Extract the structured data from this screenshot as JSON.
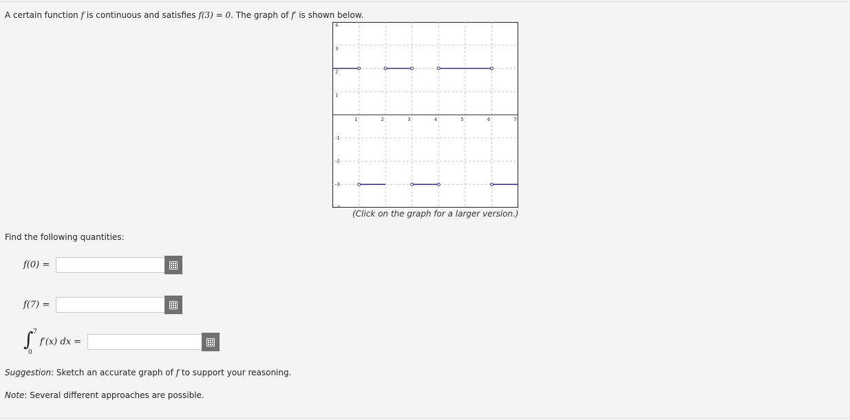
{
  "intro": {
    "part1": "A certain function ",
    "f": "f",
    "part2": " is continuous and satisfies ",
    "condition": "f(3) = 0",
    "part3": ". The graph of ",
    "fprime": "f′",
    "part4": " is shown below."
  },
  "graph": {
    "caption": "(Click on the graph for a larger version.)",
    "line_color": "#2a2aa8",
    "x_ticks": [
      "1",
      "2",
      "3",
      "4",
      "5",
      "6",
      "7"
    ],
    "y_ticks_pos": [
      "4",
      "3",
      "2",
      "1"
    ],
    "y_ticks_neg": [
      "-1",
      "-2",
      "-3",
      "-4"
    ]
  },
  "chart_data": {
    "type": "line",
    "xlim": [
      0,
      7
    ],
    "ylim": [
      -4,
      4
    ],
    "grid": true,
    "segments": [
      {
        "x": [
          0,
          1
        ],
        "y": [
          2,
          2
        ],
        "open_right": true
      },
      {
        "x": [
          1,
          2
        ],
        "y": [
          -3,
          -3
        ],
        "open_left": true
      },
      {
        "x": [
          2,
          3
        ],
        "y": [
          2,
          2
        ],
        "open_left": true,
        "open_right": true
      },
      {
        "x": [
          3,
          4
        ],
        "y": [
          -3,
          -3
        ],
        "open_left": true,
        "open_right": true
      },
      {
        "x": [
          4,
          6
        ],
        "y": [
          2,
          2
        ],
        "open_left": true,
        "open_right": true
      },
      {
        "x": [
          6,
          7
        ],
        "y": [
          -3,
          -3
        ],
        "open_left": true
      }
    ]
  },
  "prompt": "Find the following quantities:",
  "questions": {
    "q1_label": "f(0) =",
    "q1_value": "",
    "q2_label": "f(7) =",
    "q2_value": "",
    "q3_value": ""
  },
  "integral": {
    "upper": "7",
    "lower": "0",
    "integrand": "f′(x) dx ="
  },
  "suggestion": {
    "label": "Suggestion",
    "text_before": ": Sketch an accurate graph of ",
    "f": "f",
    "text_after": " to support your reasoning."
  },
  "note": {
    "label": "Note",
    "text": ": Several different approaches are possible."
  },
  "icons": {
    "answer_button": "grid-keypad-icon"
  }
}
